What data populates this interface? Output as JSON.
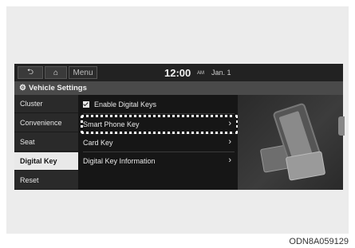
{
  "topbar": {
    "menu_label": "Menu",
    "time": "12:00",
    "ampm": "AM",
    "date": "Jan. 1"
  },
  "header": {
    "title": "Vehicle Settings"
  },
  "sidebar": {
    "items": [
      {
        "label": "Cluster"
      },
      {
        "label": "Convenience"
      },
      {
        "label": "Seat"
      },
      {
        "label": "Digital Key"
      },
      {
        "label": "Reset"
      }
    ],
    "active_index": 3
  },
  "content": {
    "enable_label": "Enable Digital Keys",
    "enable_checked": true,
    "rows": [
      {
        "label": "Smart Phone Key"
      },
      {
        "label": "Card Key"
      },
      {
        "label": "Digital Key Information"
      }
    ]
  },
  "caption": "ODN8A059129"
}
